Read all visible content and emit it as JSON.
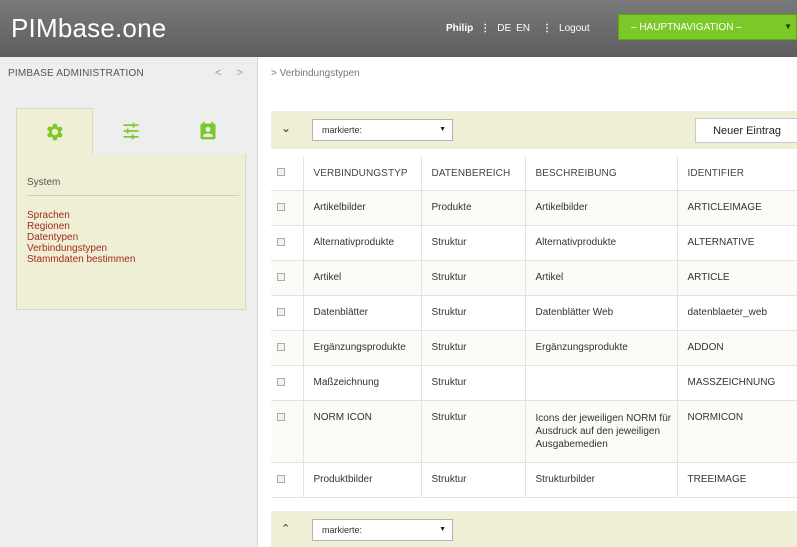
{
  "header": {
    "logo": "PIMbase.one",
    "user": "Philip",
    "lang_de": "DE",
    "lang_en": "EN",
    "logout": "Logout",
    "nav_select": "– HAUPTNAVIGATION –",
    "accent_color": "#7bc828"
  },
  "sidebar": {
    "title": "PIMBASE ADMINISTRATION",
    "arrows": "< >",
    "tabs": [
      {
        "icon": "gear-icon"
      },
      {
        "icon": "sliders-icon"
      },
      {
        "icon": "contact-card-icon"
      }
    ],
    "section": "System",
    "links": [
      "Sprachen",
      "Regionen",
      "Datentypen",
      "Verbindungstypen",
      "Stammdaten bestimmen"
    ],
    "link_color": "#a42a1e"
  },
  "main": {
    "breadcrumb": "> Verbindungstypen",
    "toolbar": {
      "select": "markierte:",
      "new_button": "Neuer Eintrag"
    },
    "table": {
      "headers": [
        "VERBINDUNGSTYP",
        "DATENBEREICH",
        "BESCHREIBUNG",
        "IDENTIFIER"
      ],
      "rows": [
        {
          "typ": "Artikelbilder",
          "bereich": "Produkte",
          "beschreibung": "Artikelbilder",
          "identifier": "ARTICLEIMAGE"
        },
        {
          "typ": "Alternativprodukte",
          "bereich": "Struktur",
          "beschreibung": "Alternativprodukte",
          "identifier": "ALTERNATIVE"
        },
        {
          "typ": "Artikel",
          "bereich": "Struktur",
          "beschreibung": "Artikel",
          "identifier": "ARTICLE"
        },
        {
          "typ": "Datenblätter",
          "bereich": "Struktur",
          "beschreibung": "Datenblätter Web",
          "identifier": "datenblaeter_web"
        },
        {
          "typ": "Ergänzungsprodukte",
          "bereich": "Struktur",
          "beschreibung": "Ergänzungsprodukte",
          "identifier": "ADDON"
        },
        {
          "typ": "Maßzeichnung",
          "bereich": "Struktur",
          "beschreibung": "",
          "identifier": "MASSZEICHNUNG"
        },
        {
          "typ": "NORM ICON",
          "bereich": "Struktur",
          "beschreibung": "Icons der jeweiligen NORM für Ausdruck auf den jeweiligen Ausgabemedien",
          "identifier": "NORMICON"
        },
        {
          "typ": "Produktbilder",
          "bereich": "Struktur",
          "beschreibung": "Strukturbilder",
          "identifier": "TREEIMAGE"
        }
      ]
    },
    "bottom": {
      "select": "markierte:"
    }
  }
}
